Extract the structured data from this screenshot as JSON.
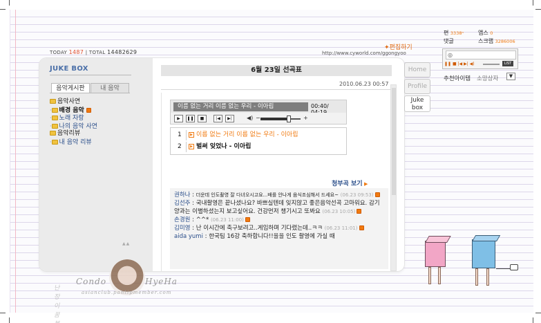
{
  "header": {
    "today_label": "TODAY",
    "today_count": "1487",
    "total_label": "TOTAL",
    "total_count": "14482629",
    "edit_link": "편집하기",
    "url": "http://www.cyworld.com/ggongyoo"
  },
  "sidebar": {
    "title": "JUKE BOX",
    "tabs": [
      "음악게시판",
      "내 음악"
    ],
    "tree": [
      {
        "label": "음악사연",
        "level": 0,
        "new": false
      },
      {
        "label": "배경 음악",
        "level": 1,
        "new": true,
        "bold": true
      },
      {
        "label": "노래 자랑",
        "level": 1,
        "new": false
      },
      {
        "label": "나의 음악 사연",
        "level": 1,
        "new": false
      },
      {
        "label": "음악리뷰",
        "level": 0,
        "new": false
      },
      {
        "label": "내 음악 리뷰",
        "level": 1,
        "new": false
      }
    ],
    "scroll_hint": "▲▲"
  },
  "playlist": {
    "title": "6월 23일 선곡표",
    "date": "2010.06.23 00:57",
    "player": {
      "now_playing": "이름 없는 거리 이름 없는 우리 - 이아립",
      "time": "00:40/ 04:19",
      "volume_percent": 70,
      "controls": [
        "play",
        "pause",
        "stop",
        "prev",
        "next"
      ]
    },
    "tracks": [
      {
        "num": "1",
        "title": "이름 없는 거리 이름 없는 우리 - 이아립",
        "active": true
      },
      {
        "num": "2",
        "title": "벌써 잊었나 - 이아립",
        "active": false
      }
    ],
    "ost_link": "청부곡 보기"
  },
  "comments": [
    {
      "name": "권하나",
      "text": "더운데 인도촬영 잘 다녀오시고요...배를 안나게 음식조심해서 드세요~",
      "ts": "(06.23 09:53)"
    },
    {
      "name": "김선주",
      "text": "국내촬영은 끝나셨나요? 바쁘실텐데 잊지않고 좋은음악선곡 고마워요. 감기양과는 이별하셨는지 보고싶어요. 건강먼저 챙기시고 또봐요",
      "ts": "(06.23 10:05)"
    },
    {
      "name": "손경원",
      "text": "^^*",
      "ts": "(06.23 11:00)"
    },
    {
      "name": "김미영",
      "text": "난 이시간에 축구보려고..게임하며 기다렸는데..ㅋㅋ",
      "ts": "(06.23 11:01)"
    },
    {
      "name": "aida yumi",
      "text": "한국팀 16강 축하합니다!!을을 인도 촬영에 가실 때",
      "ts": ""
    }
  ],
  "side_tabs": [
    "Home",
    "Profile",
    "Juke box"
  ],
  "right_widget": {
    "links": [
      {
        "label": "편",
        "count": "3338"
      },
      {
        "label": "댓글",
        "count": ""
      },
      {
        "label": "앱스",
        "count": "0"
      },
      {
        "label": "스크랩",
        "count": "3286006"
      }
    ],
    "mini_player_text": "◎ ",
    "list_label": "LIST",
    "recommend": "추천아이템",
    "recommend2": "소망상자"
  },
  "signature": {
    "left": "Condo",
    "right": "HyeHa",
    "url": "asianclub.pantipmember.com",
    "korean": "난장이 꿈 봉중"
  },
  "colors": {
    "accent": "#f07a10",
    "link_blue": "#2a4e8a",
    "title_blue": "#4a6fa8"
  }
}
